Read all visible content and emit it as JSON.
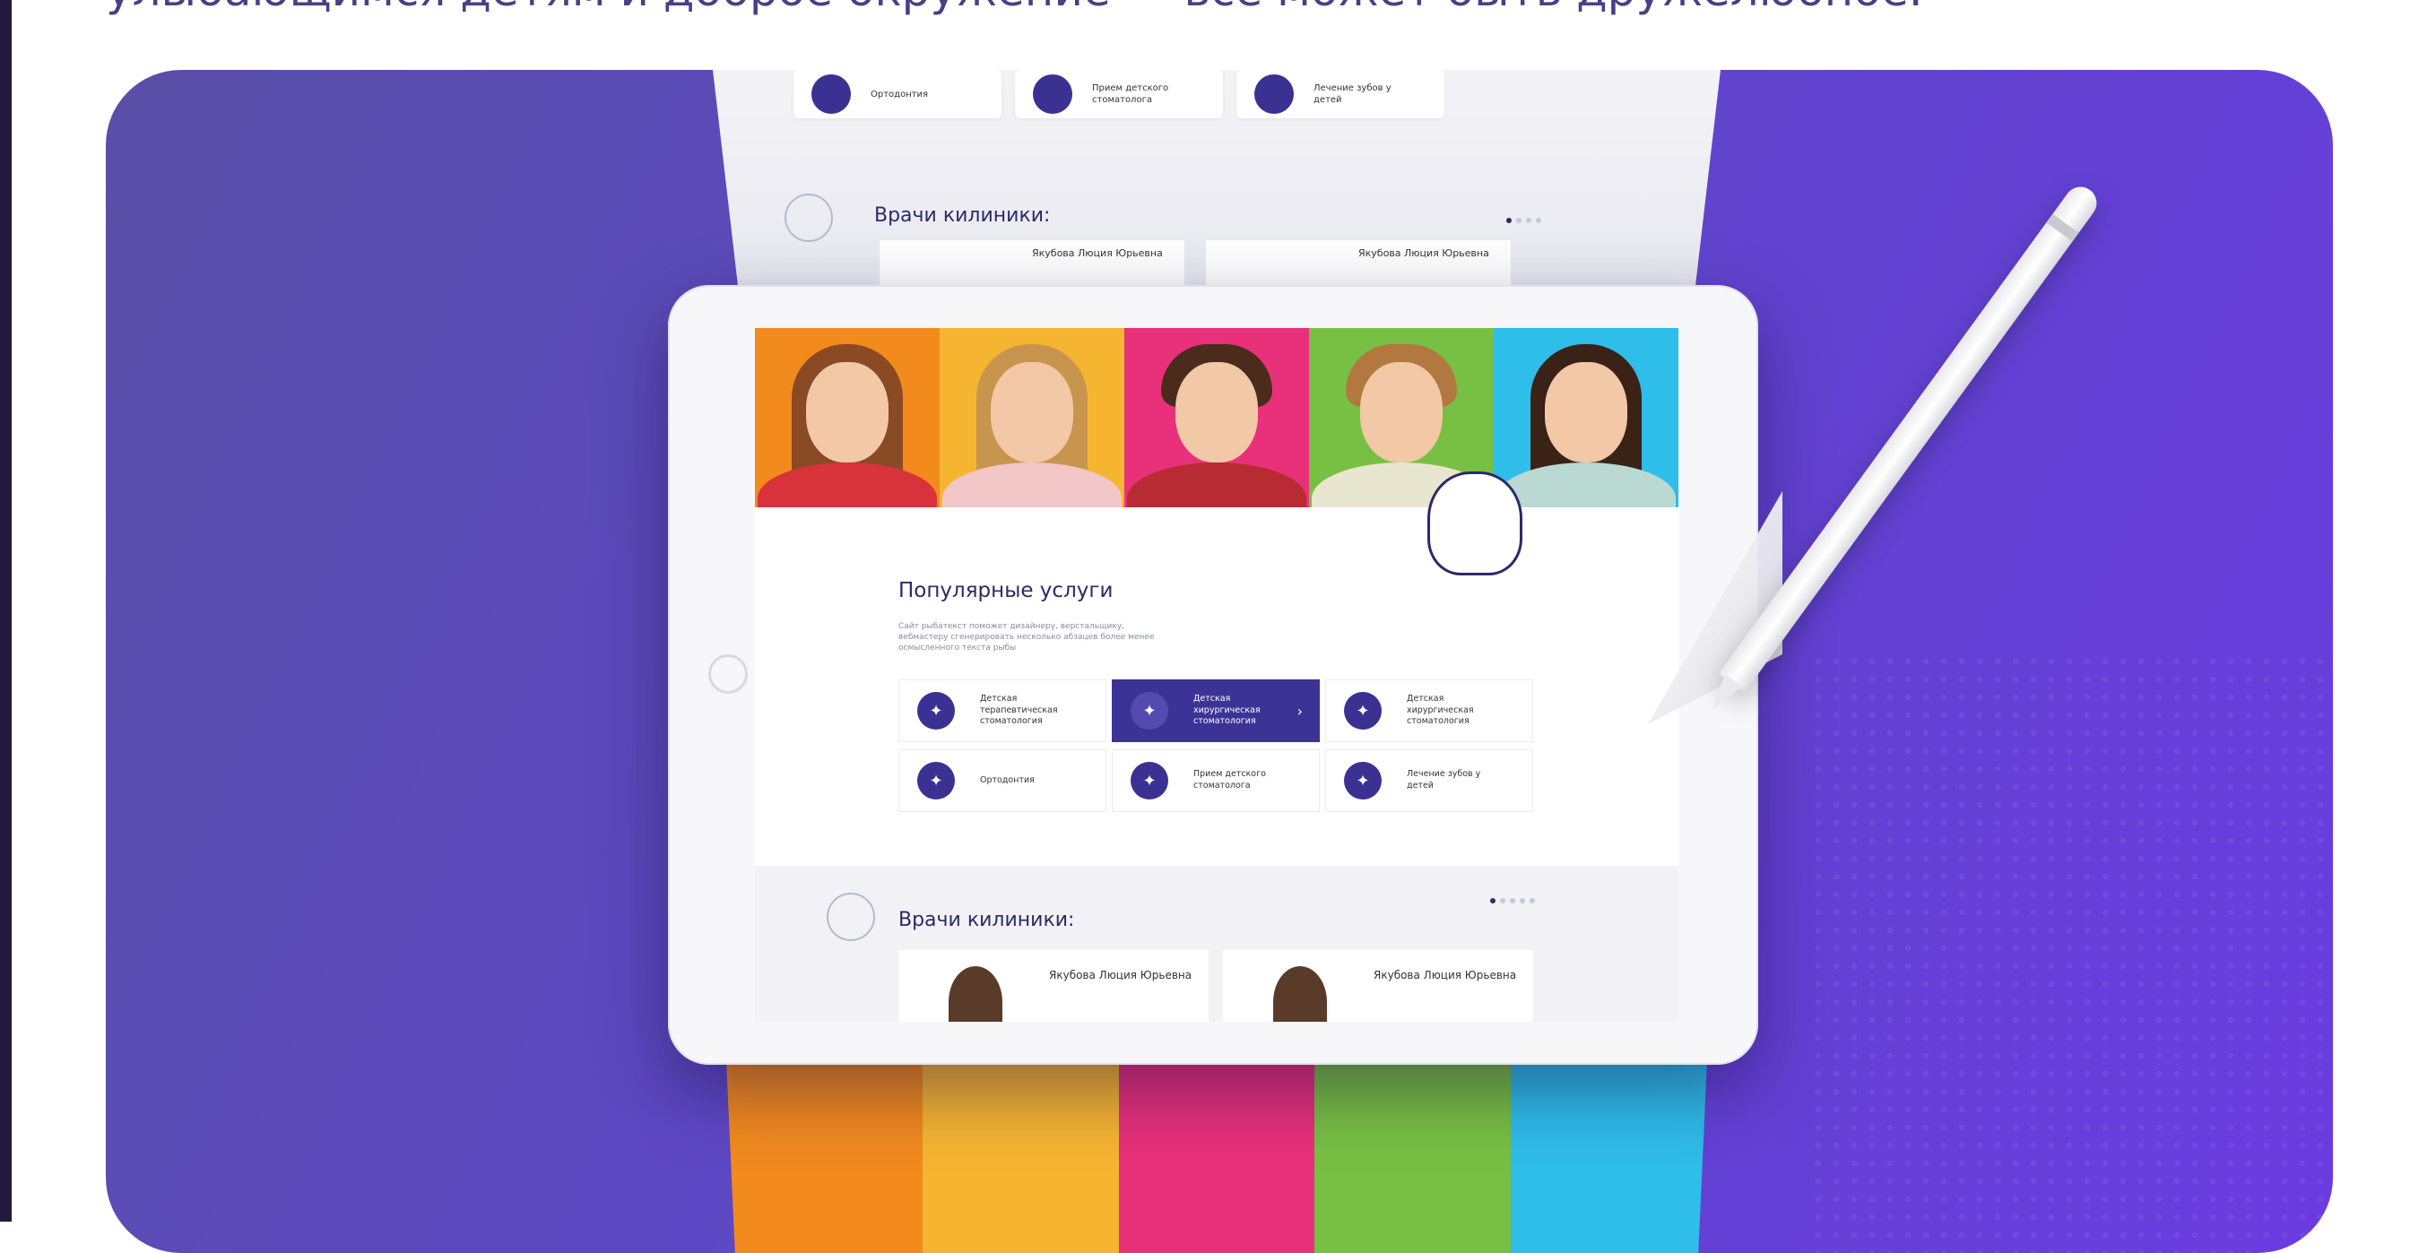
{
  "header": {
    "text": "улыбающимся детям и доброе окружение — все может быть дружелюбное."
  },
  "colors": {
    "brand": "#3b3496",
    "bg_start": "#5a4fa7",
    "bg_end": "#6a3ce0",
    "photo_bg": [
      "#f28a1e",
      "#f6b531",
      "#e8317a",
      "#78c043",
      "#2fbdea"
    ]
  },
  "site": {
    "popular": {
      "title": "Популярные услуги",
      "description": "Сайт рыбатекст поможет дизайнеру, верстальщику, вебмастеру сгенерировать несколько абзацев более менее осмысленного текста рыбы"
    },
    "services": [
      {
        "label": "Детская терапевтическая стоматология",
        "icon": "tooth-icon"
      },
      {
        "label": "Детская хирургическая стоматология",
        "icon": "tooth-icon",
        "active": true
      },
      {
        "label": "Детская хирургическая стоматология",
        "icon": "tooth-icon"
      },
      {
        "label": "Ортодонтия",
        "icon": "tooth-icon"
      },
      {
        "label": "Прием детского стоматолога",
        "icon": "tooth-icon"
      },
      {
        "label": "Лечение зубов у детей",
        "icon": "tooth-icon"
      }
    ],
    "doctors": {
      "title": "Врачи килиники:",
      "cards": [
        {
          "name": "Якубова Люция Юрьевна"
        },
        {
          "name": "Якубова Люция Юрьевна"
        }
      ]
    }
  },
  "back_page": {
    "services": [
      {
        "label": "Ортодонтия"
      },
      {
        "label": "Прием детского стоматолога"
      },
      {
        "label": "Лечение зубов у детей"
      }
    ],
    "doctors_title": "Врачи килиники:",
    "doctor_names": [
      "Якубова Люция Юрьевна",
      "Якубова Люция Юрьевна"
    ]
  }
}
